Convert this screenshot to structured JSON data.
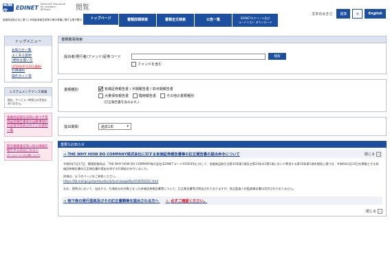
{
  "header": {
    "logo_mark": "金融庁",
    "logo_text": "EDINET",
    "logo_sub": "Electronic Disclosure for Investors' NETwork",
    "logo_kanji": "閲覧",
    "tagline": "金融商品取引法に基づく有価証券報告書等の開示書類に関する電子開示システム",
    "nav": [
      {
        "label": "トップページ",
        "active": true
      },
      {
        "label": "書類詳細検索",
        "active": false
      },
      {
        "label": "書類全文検索",
        "active": false
      },
      {
        "label": "公告一覧",
        "active": false
      },
      {
        "label": "EDINETタクソノミ及び\nコードリスト ダウンロード",
        "active": false
      }
    ],
    "font_size_label": "文字の大きさ",
    "font_std": "標準",
    "font_large": "大",
    "english": "English"
  },
  "sidebar": {
    "menu_title": "トップメニュー",
    "links": [
      "お知らせ一覧",
      "よくある質問",
      "(便利な使い方",
      "利用規約",
      "操作ガイド等"
    ],
    "faq_note": "(2024年07月31日更新)",
    "maint_title": "システムメンテナンス情報",
    "maint_body": "現在、サービス一時停止の予定はありません。",
    "pink1": "金融商品取引法等に基づき有価証券報告書等の記載事項の訂正等が求められている会社一覧",
    "pink2": "開示義務違反等に係る情報を紹介する方はこちらへ",
    "pink2_small": "(ホームページへの公開について)"
  },
  "search": {
    "section_title": "書類簡易検索",
    "name_label": "提出者/発行者/ファンド/証券コード",
    "name_value": "",
    "search_button": "検索",
    "include_fund": "ファンドを含む",
    "doc_type_label": "書類種別",
    "doc_types": [
      {
        "label": "有価証券報告書 / 半期報告書 / 四半期報告書",
        "checked": true
      },
      {
        "label": "大量保有報告書",
        "checked": false
      },
      {
        "label": "臨時報告書",
        "checked": false
      },
      {
        "label": "その他の書類種別",
        "checked": false
      }
    ],
    "doc_note": "(訂正報告書を含みます。)",
    "period_label": "提出期間",
    "period_value": "過去1年"
  },
  "news": {
    "header": "重要なお知らせ",
    "item1_title": "THE WHY HOW DO COMPANY株式会社に対する有価証券報告書等の訂正報告書の提出命令について",
    "toggle_label": "閉じる",
    "item1_p1": "令和6年7月17日、関東財務局は、THE WHY HOW DO COMPANY株式会社(EDINETコード:E05030)に対して、金融商品取引法第10条第1項及び第24条の2第1項において準用する第10条第1項の規定に基づき、令和6年5月10日を期限とする有価証券報告書の訂正報告書の提出を命ずる行政処分を行いました。",
    "item1_p2": "詳細は、以下のページをご参照ください。",
    "item1_url": "https://lfb.mof.go.jp/kantou/disclo/kuchi/page6tp/019030031.html",
    "item1_p3": "なお、現時点において、当社から、行政処分の対象となった有価証券報告書等について、訂正報告書等が提出されておりますが、独立監査人の監査報告書は添付されておりません。",
    "item2_title": "物下券の発行型株及びその訂正書類等を提出される方へ",
    "item2_warn": "必ずご確認ください。"
  }
}
